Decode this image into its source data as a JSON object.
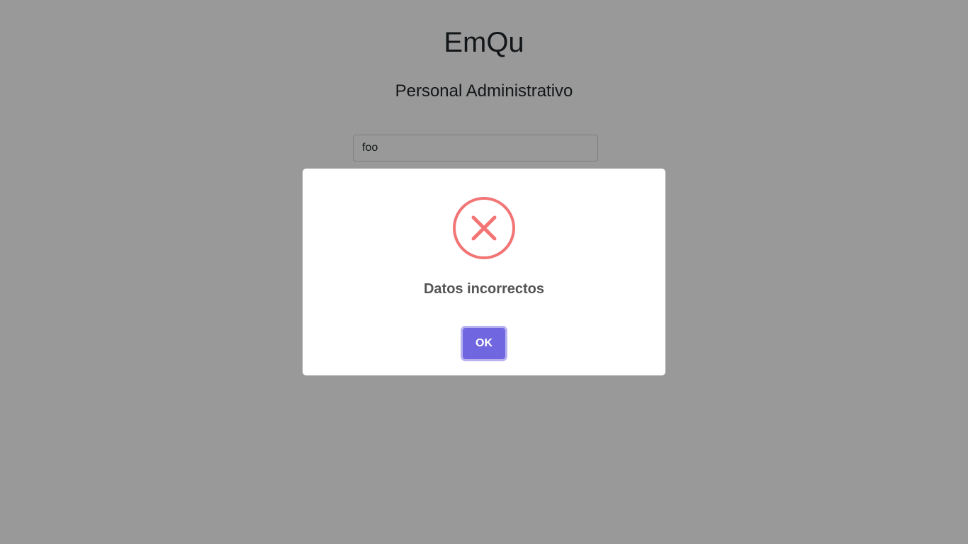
{
  "app": {
    "title": "EmQu",
    "subtitle": "Personal Administrativo"
  },
  "login_form": {
    "username_value": "foo"
  },
  "alert": {
    "icon": "error-x-icon",
    "title": "Datos incorrectos",
    "confirm_label": "OK"
  },
  "colors": {
    "overlay": "rgba(0,0,0,0.4)",
    "error_icon": "#f27474",
    "confirm_button": "#7066e0",
    "title_text": "#545454"
  }
}
